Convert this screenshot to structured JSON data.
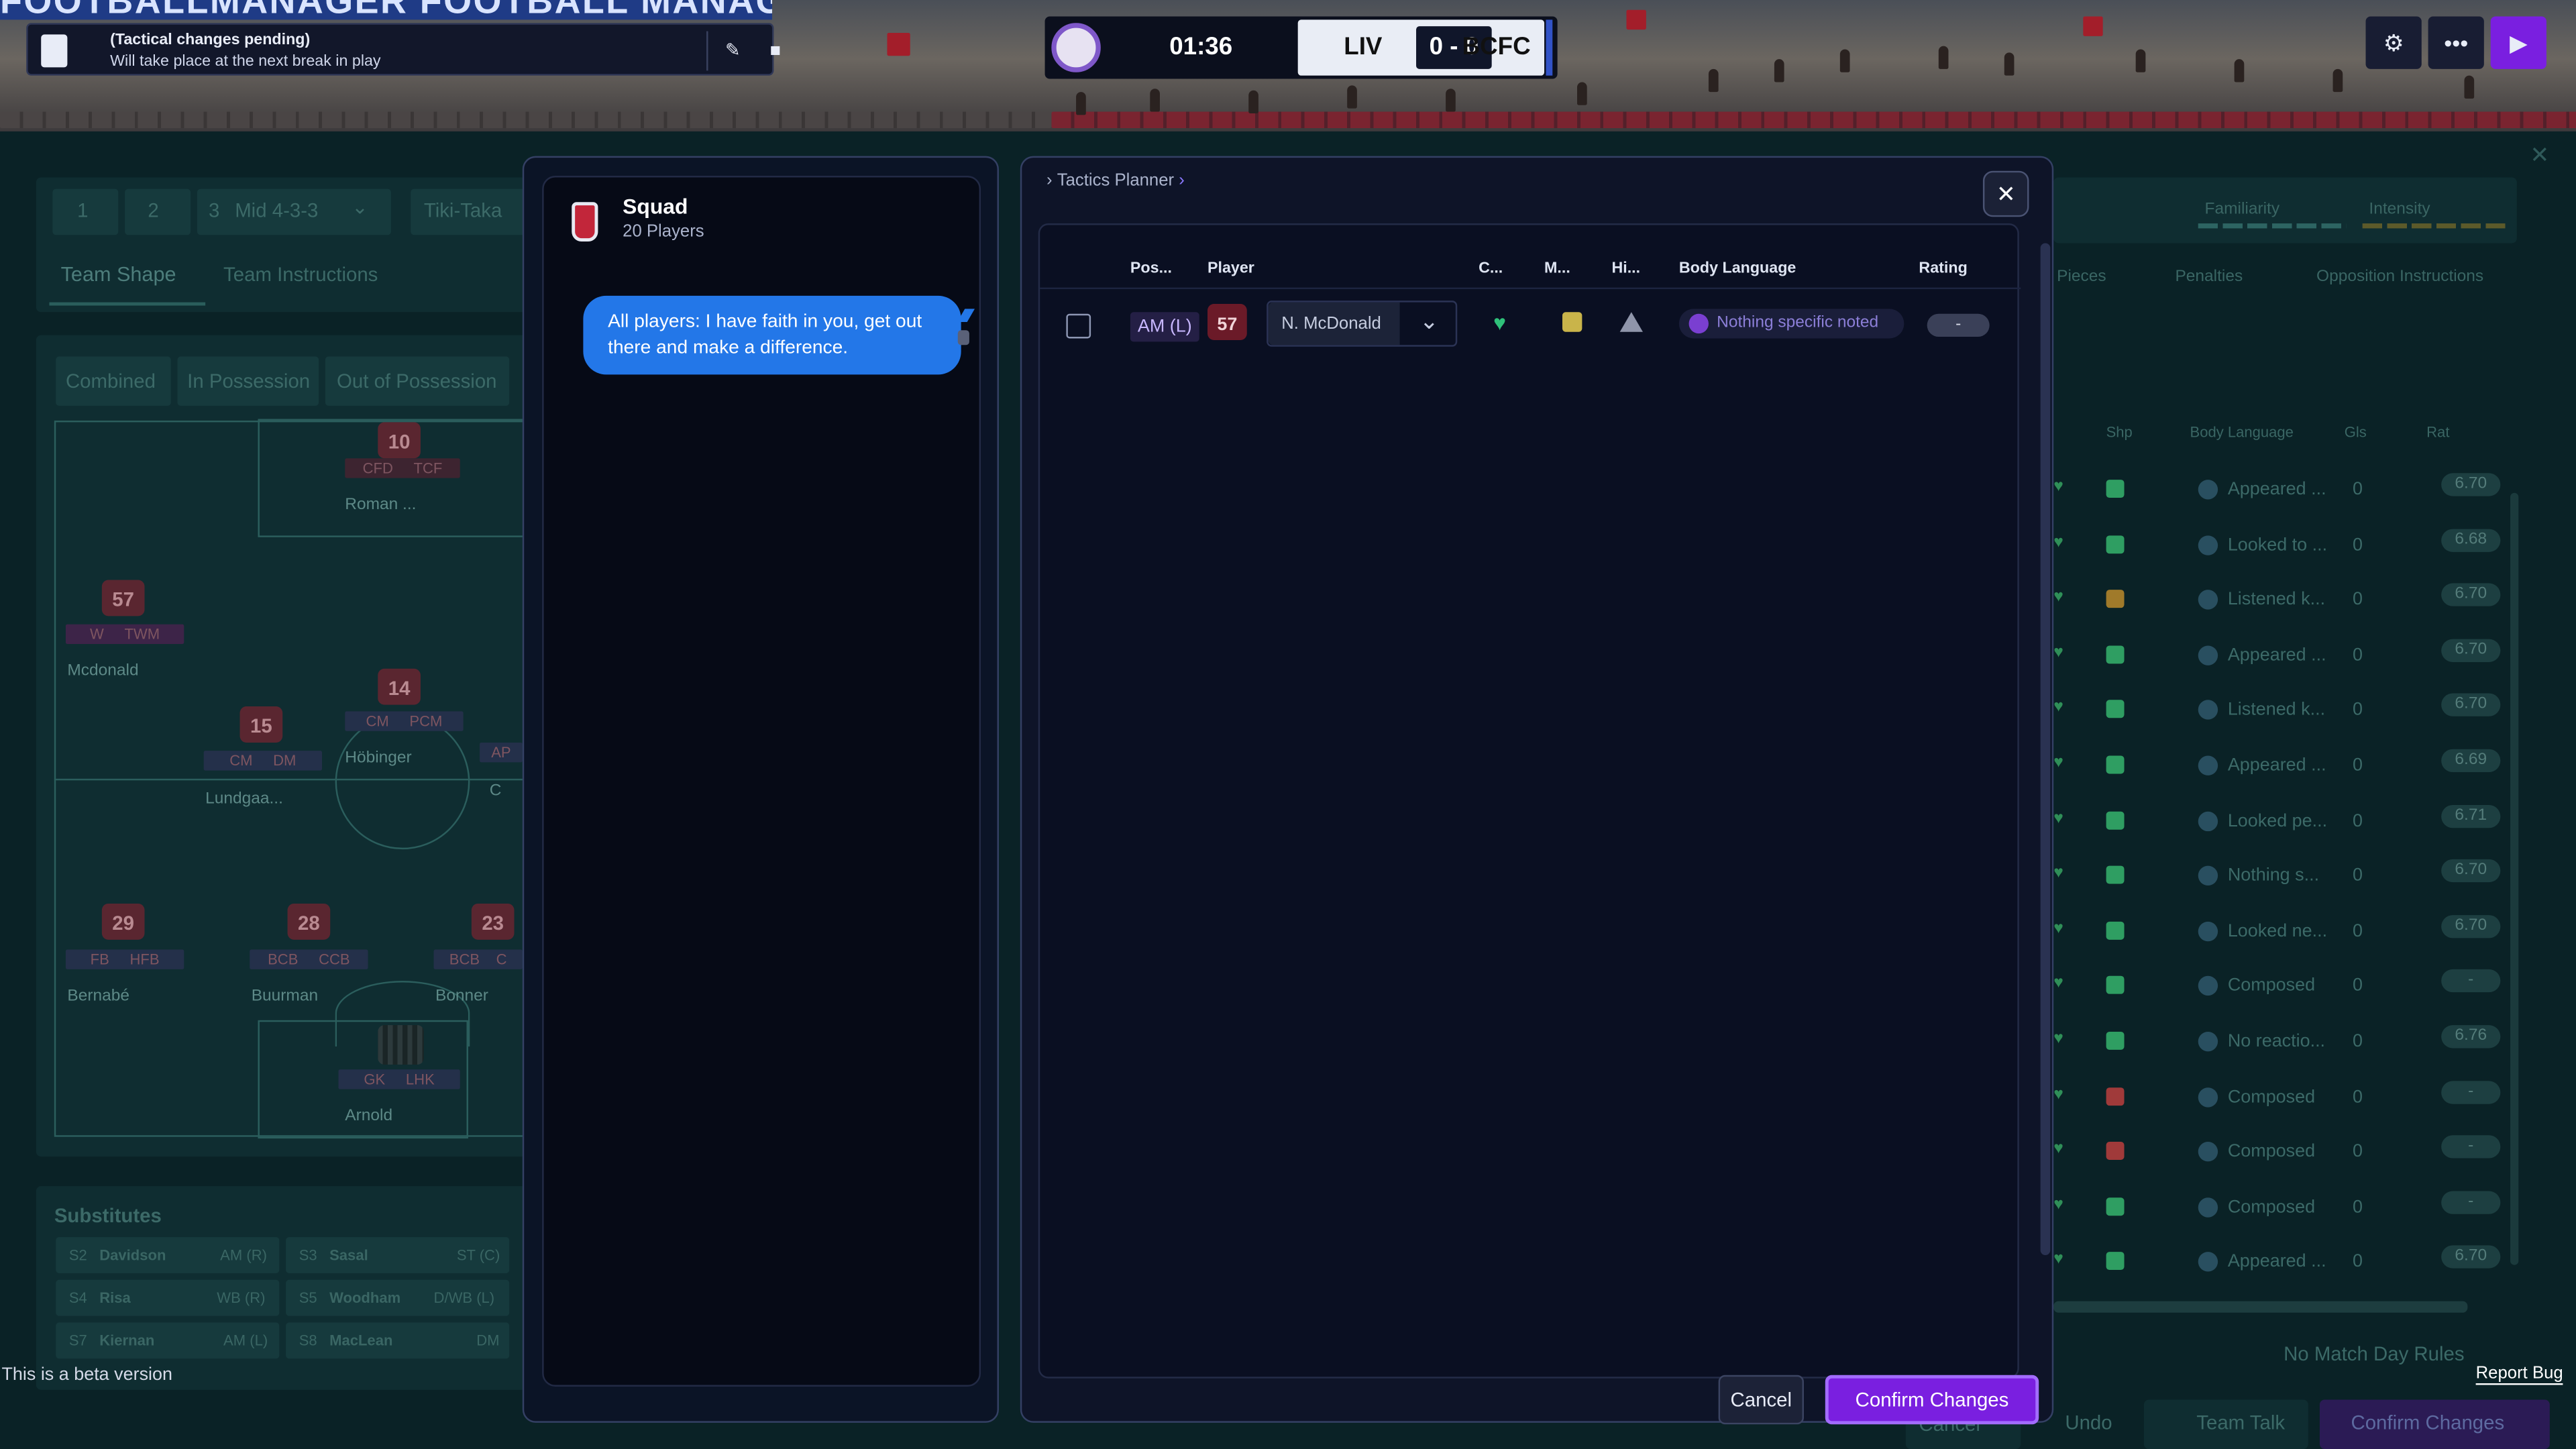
{
  "banner": {
    "text": "FOOTBALLMANAGER  FOOTBALL MANAGER"
  },
  "notification": {
    "title": "(Tactical changes pending)",
    "subtitle": "Will take place at the next break in play"
  },
  "scoreboard": {
    "clock": "01:36",
    "home": "LIV",
    "score": "0 - 0",
    "away": "BCFC"
  },
  "background": {
    "tactic_tabs": [
      "1",
      "2",
      "3"
    ],
    "formation": "Mid 4-3-3",
    "style": "Tiki-Taka",
    "subtabs": [
      "Team Shape",
      "Team Instructions"
    ],
    "view_tabs": [
      "Combined",
      "In Possession",
      "Out of Possession"
    ],
    "meters": [
      "Familiarity",
      "Intensity"
    ],
    "right_tabs": [
      "Pieces",
      "Penalties",
      "Opposition Instructions"
    ],
    "table_headers": [
      "Shp",
      "Body Language",
      "Gls",
      "Rat"
    ],
    "players": [
      {
        "shirt": "10",
        "pos1": "CFD",
        "pos2": "TCF",
        "name": "Roman ..."
      },
      {
        "shirt": "57",
        "pos1": "W",
        "pos2": "TWM",
        "name": "Mcdonald"
      },
      {
        "shirt": "14",
        "pos1": "CM",
        "pos2": "PCM",
        "name": "Höbinger"
      },
      {
        "shirt": "15",
        "pos1": "CM",
        "pos2": "DM",
        "name": "Lundgaa..."
      },
      {
        "shirt": "29",
        "pos1": "FB",
        "pos2": "HFB",
        "name": "Bernabé"
      },
      {
        "shirt": "28",
        "pos1": "BCB",
        "pos2": "CCB",
        "name": "Buurman"
      },
      {
        "shirt": "23",
        "pos1": "BCB",
        "pos2": "C",
        "name": "Bonner"
      },
      {
        "shirt": "",
        "pos1": "GK",
        "pos2": "LHK",
        "name": "Arnold"
      },
      {
        "shirt": "",
        "pos1": "AP",
        "pos2": "",
        "name": "C"
      }
    ],
    "substitutes_title": "Substitutes",
    "substitutes": [
      {
        "num": "S2",
        "name": "Davidson",
        "pos": "AM (R)"
      },
      {
        "num": "S3",
        "name": "Sasal",
        "pos": "ST (C)"
      },
      {
        "num": "S4",
        "name": "Risa",
        "pos": "WB (R)"
      },
      {
        "num": "S5",
        "name": "Woodham",
        "pos": "D/WB (L)"
      },
      {
        "num": "S7",
        "name": "Kiernan",
        "pos": "AM (L)"
      },
      {
        "num": "S8",
        "name": "MacLean",
        "pos": "DM"
      }
    ],
    "rows": [
      {
        "bl": "Appeared ...",
        "gls": "0",
        "rat": "6.70",
        "chk": "green"
      },
      {
        "bl": "Looked to ...",
        "gls": "0",
        "rat": "6.68",
        "chk": "green"
      },
      {
        "bl": "Listened k...",
        "gls": "0",
        "rat": "6.70",
        "chk": "amber"
      },
      {
        "bl": "Appeared ...",
        "gls": "0",
        "rat": "6.70",
        "chk": "green"
      },
      {
        "bl": "Listened k...",
        "gls": "0",
        "rat": "6.70",
        "chk": "green"
      },
      {
        "bl": "Appeared ...",
        "gls": "0",
        "rat": "6.69",
        "chk": "green"
      },
      {
        "bl": "Looked pe...",
        "gls": "0",
        "rat": "6.71",
        "chk": "green"
      },
      {
        "bl": "Nothing s...",
        "gls": "0",
        "rat": "6.70",
        "chk": "green"
      },
      {
        "bl": "Looked ne...",
        "gls": "0",
        "rat": "6.70",
        "chk": "green"
      },
      {
        "bl": "Composed",
        "gls": "0",
        "rat": "-",
        "chk": "green"
      },
      {
        "bl": "No reactio...",
        "gls": "0",
        "rat": "6.76",
        "chk": "green"
      },
      {
        "bl": "Composed",
        "gls": "0",
        "rat": "-",
        "chk": "red"
      },
      {
        "bl": "Composed",
        "gls": "0",
        "rat": "-",
        "chk": "red"
      },
      {
        "bl": "Composed",
        "gls": "0",
        "rat": "-",
        "chk": "green"
      },
      {
        "bl": "Appeared ...",
        "gls": "0",
        "rat": "6.70",
        "chk": "green"
      }
    ],
    "match_rules": "No Match Day Rules",
    "footer_buttons": [
      "Cancel",
      "Undo",
      "Team Talk",
      "Confirm Changes"
    ]
  },
  "squad": {
    "title": "Squad",
    "subtitle": "20 Players",
    "message": "All players: I have faith in you, get out there and make a difference."
  },
  "planner": {
    "breadcrumb": "Tactics Planner",
    "headers": [
      "Pos...",
      "Player",
      "C...",
      "M...",
      "Hi...",
      "Body Language",
      "Rating"
    ],
    "row": {
      "pos": "AM (L)",
      "shirt": "57",
      "player": "N. McDonald",
      "body_language": "Nothing specific noted",
      "rating": "-"
    },
    "cancel": "Cancel",
    "confirm": "Confirm Changes"
  },
  "footer": {
    "beta": "This is a beta version",
    "report": "Report Bug"
  },
  "colors": {
    "accent": "#7a1fe0",
    "bubble": "#2377e8",
    "positive": "#2f9e62"
  }
}
